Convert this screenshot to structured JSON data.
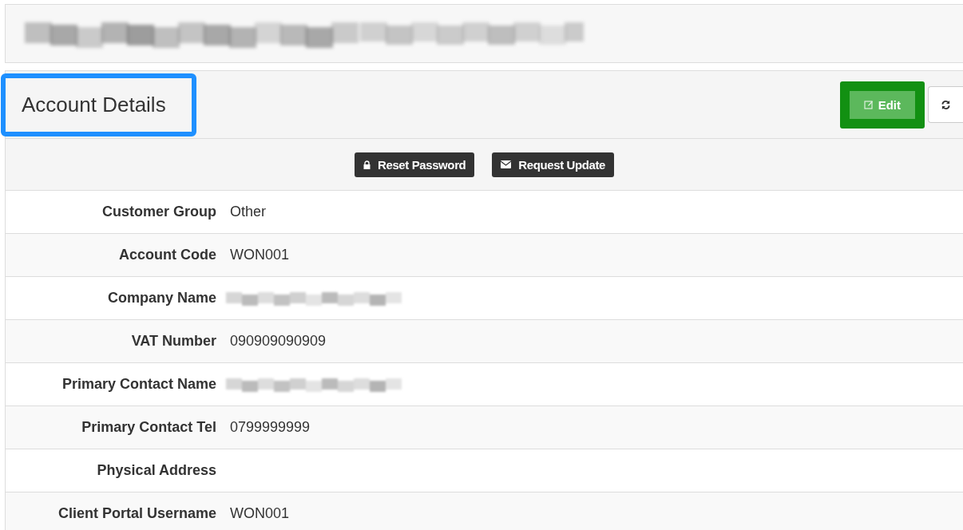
{
  "top_bar": {
    "kind": "redacted"
  },
  "panel": {
    "title": "Account Details",
    "title_highlighted": true,
    "edit_button": {
      "label": "Edit",
      "highlighted": true
    },
    "actions": [
      {
        "label": "Reset Password",
        "kind": "lock"
      },
      {
        "label": "Request Update",
        "kind": "envelope"
      }
    ],
    "rows": [
      {
        "label": "Customer Group",
        "value": "Other",
        "kind": "text"
      },
      {
        "label": "Account Code",
        "value": "WON001",
        "kind": "text"
      },
      {
        "label": "Company Name",
        "kind": "redacted"
      },
      {
        "label": "VAT Number",
        "value": "090909090909",
        "kind": "text"
      },
      {
        "label": "Primary Contact Name",
        "kind": "redacted"
      },
      {
        "label": "Primary Contact Tel",
        "value": "0799999999",
        "kind": "text"
      },
      {
        "label": "Physical Address",
        "kind": "empty"
      },
      {
        "label": "Client Portal Username",
        "value": "WON001",
        "kind": "text"
      }
    ]
  }
}
